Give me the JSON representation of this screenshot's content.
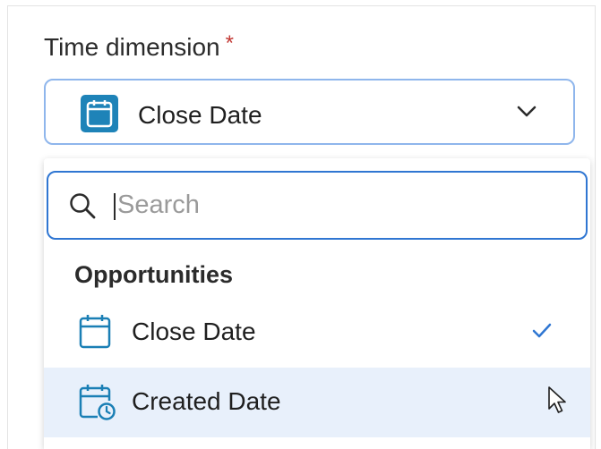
{
  "field": {
    "label": "Time dimension",
    "required_mark": "*",
    "selected_value": "Close Date",
    "selected_icon": "calendar-icon"
  },
  "dropdown": {
    "search_placeholder": "Search",
    "search_value": "",
    "group": {
      "label": "Opportunities",
      "items": [
        {
          "label": "Close Date",
          "icon": "calendar-icon",
          "selected": true
        },
        {
          "label": "Created Date",
          "icon": "calendar-clock-icon",
          "selected": false,
          "hovered": true
        }
      ]
    }
  },
  "colors": {
    "accent": "#2f76d2",
    "calendar_badge": "#1e83b8",
    "icon_blue": "#1a7fb5",
    "hover_bg": "#e8f0fb",
    "required": "#c23934"
  }
}
